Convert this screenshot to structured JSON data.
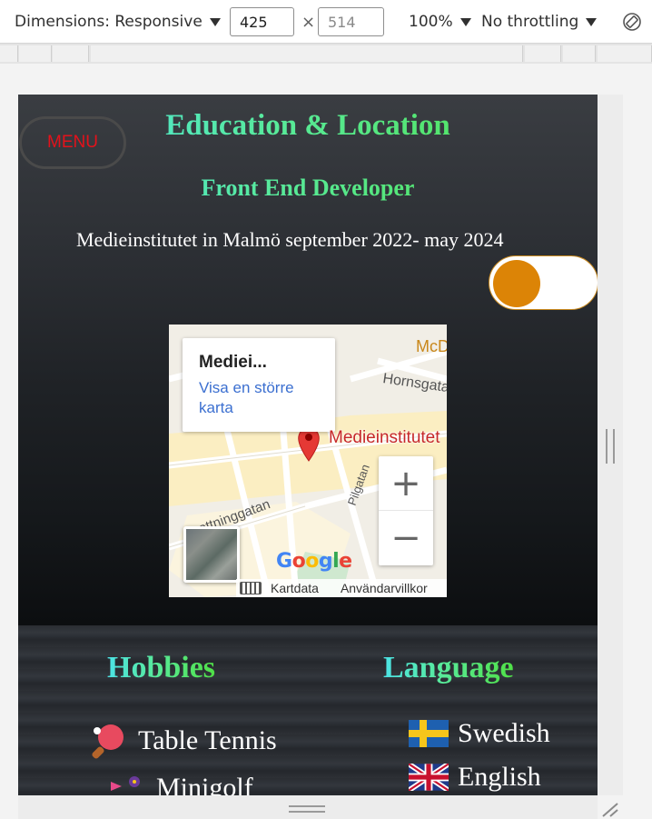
{
  "devtools": {
    "dimensions_label": "Dimensions: Responsive",
    "width_value": "425",
    "height_placeholder": "514",
    "times_sign": "×",
    "zoom": "100%",
    "throttling": "No throttling"
  },
  "page": {
    "menu_label": "MENU",
    "title": "Education & Location",
    "subtitle": "Front End Developer",
    "education_text": "Medieinstitutet in Malmö september 2022- may 2024",
    "toggle_on": false
  },
  "map": {
    "info_title": "Mediei...",
    "info_link": "Visa en större karta",
    "pin_label": "Medieinstitutet",
    "street_labels": [
      "Hornsgatan",
      "Drottninggatan",
      "Pilgatan",
      "McD"
    ],
    "zoom_in": "+",
    "zoom_out": "−",
    "google_logo": [
      "G",
      "o",
      "o",
      "g",
      "l",
      "e"
    ],
    "footer_mapdata": "Kartdata",
    "footer_terms": "Användarvillkor"
  },
  "hobbies": {
    "heading": "Hobbies",
    "items": [
      {
        "label": "Table Tennis",
        "icon": "ping-pong-icon"
      },
      {
        "label": "Minigolf",
        "icon": "minigolf-icon"
      }
    ]
  },
  "languages": {
    "heading": "Language",
    "items": [
      {
        "label": "Swedish",
        "icon": "swedish-flag-icon"
      },
      {
        "label": "English",
        "icon": "uk-flag-icon"
      }
    ]
  },
  "colors": {
    "menu_text": "#e3121b",
    "toggle_knob": "#dc8406",
    "heading_gradient_start": "#4ce3e6",
    "heading_gradient_end": "#50e046"
  }
}
